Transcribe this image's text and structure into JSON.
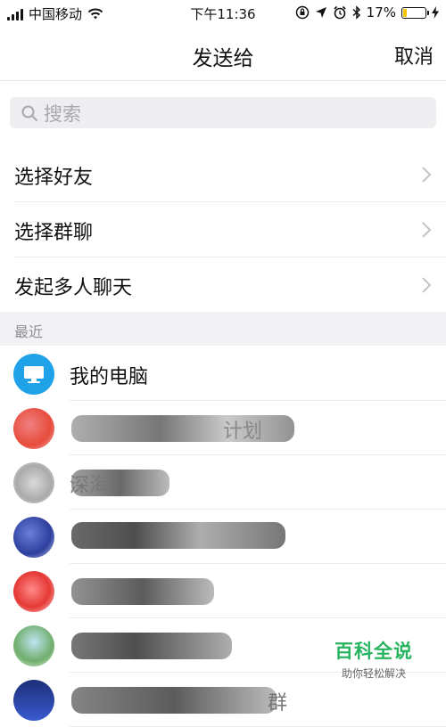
{
  "status_bar": {
    "carrier": "中国移动",
    "time": "下午11:36",
    "battery_percent": "17%",
    "battery_level": 0.17,
    "battery_color": "#f5c300"
  },
  "nav": {
    "title": "发送给",
    "cancel": "取消"
  },
  "search": {
    "placeholder": "搜索"
  },
  "menu": {
    "items": [
      {
        "label": "选择好友"
      },
      {
        "label": "选择群聊"
      },
      {
        "label": "发起多人聊天"
      }
    ]
  },
  "recent": {
    "section_label": "最近",
    "items": [
      {
        "name": "我的电脑",
        "icon": "monitor-icon"
      },
      {
        "name": "计划"
      },
      {
        "name": "深海"
      },
      {
        "name": ""
      },
      {
        "name": ""
      },
      {
        "name": ""
      },
      {
        "name": "群"
      }
    ]
  },
  "watermark": {
    "title": "百科全说",
    "subtitle": "助你轻松解决"
  },
  "colors": {
    "accent_blue": "#1fa2e8",
    "watermark_green": "#27b45e"
  }
}
